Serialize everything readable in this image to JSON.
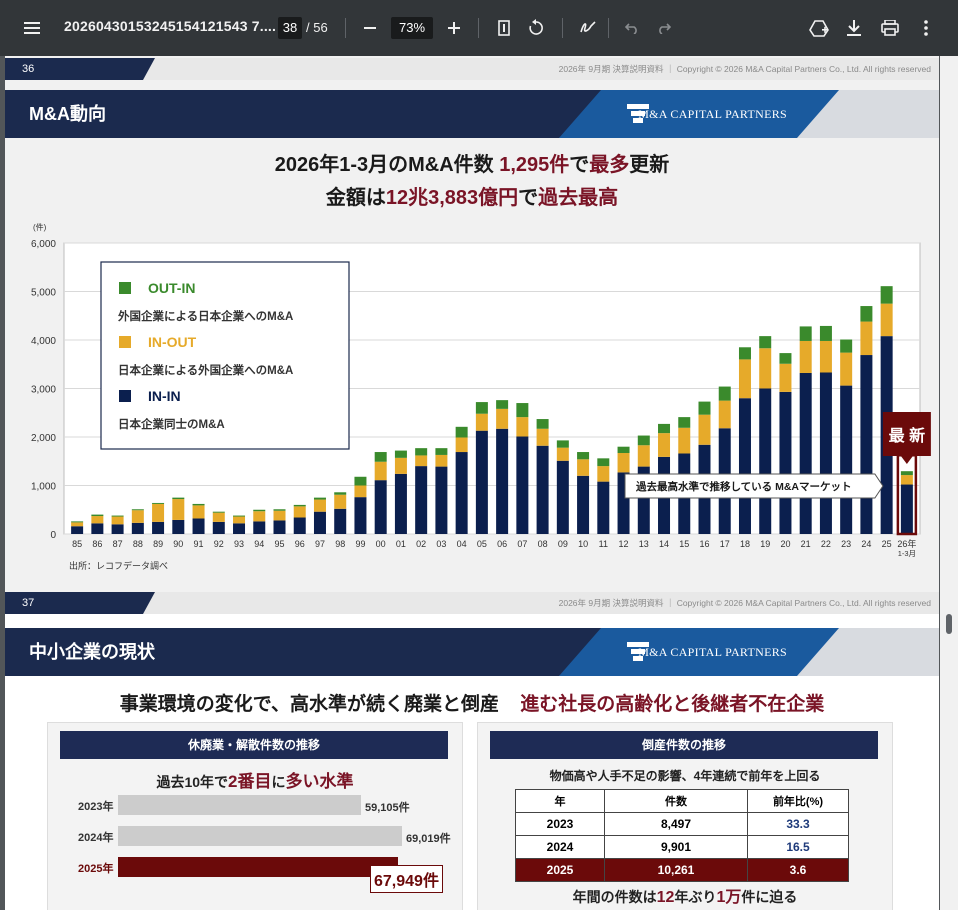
{
  "toolbar": {
    "menu_icon": "hamburger-menu-icon",
    "doc_title": "20260430153245154121543 7....",
    "page_current": "38",
    "page_total": "/ 56",
    "zoom": "73%",
    "icons": [
      "zoom-out-icon",
      "zoom-in-icon",
      "fit-page-icon",
      "rotate-icon",
      "annotate-icon",
      "undo-icon",
      "redo-icon",
      "drive-icon",
      "download-icon",
      "print-icon",
      "more-icon"
    ]
  },
  "page36": {
    "top_page_num": "36",
    "footer_copy": "2026年 9月期 決算説明資料 ｜ Copyright © 2026 M&A Capital Partners Co., Ltd. All rights reserved",
    "section_title": "M&A動向",
    "logo_text": "M&A CAPITAL PARTNERS",
    "headline1_a": "2026年1-3月のM&A件数 ",
    "headline1_b": "1,295件",
    "headline1_c": "で",
    "headline1_d": "最多",
    "headline1_e": "更新",
    "headline2_a": "金額は",
    "headline2_b": "12兆3,883億円",
    "headline2_c": "で",
    "headline2_d": "過去最高",
    "source": "出所：レコフデータ調べ",
    "badge": "最 新",
    "callout": "過去最高水準で推移している M&Aマーケット"
  },
  "chart_data": {
    "type": "bar",
    "stacked": true,
    "yunit": "(件)",
    "ylim": [
      0,
      6000
    ],
    "yticks": [
      "0",
      "1,000",
      "2,000",
      "3,000",
      "4,000",
      "5,000",
      "6,000"
    ],
    "categories": [
      "85",
      "86",
      "87",
      "88",
      "89",
      "90",
      "91",
      "92",
      "93",
      "94",
      "95",
      "96",
      "97",
      "98",
      "99",
      "00",
      "01",
      "02",
      "03",
      "04",
      "05",
      "06",
      "07",
      "08",
      "09",
      "10",
      "11",
      "12",
      "13",
      "14",
      "15",
      "16",
      "17",
      "18",
      "19",
      "20",
      "21",
      "22",
      "23",
      "24",
      "25",
      "26年\n1-3月"
    ],
    "series": [
      {
        "name": "IN-IN",
        "color": "#0b1f4e",
        "values": [
          160,
          220,
          200,
          230,
          250,
          290,
          320,
          250,
          220,
          260,
          280,
          340,
          460,
          520,
          760,
          1110,
          1240,
          1400,
          1390,
          1690,
          2130,
          2170,
          2010,
          1820,
          1510,
          1200,
          1080,
          1270,
          1390,
          1590,
          1660,
          1840,
          2180,
          2800,
          3000,
          2930,
          3320,
          3330,
          3060,
          3690,
          4080,
          1020
        ]
      },
      {
        "name": "OUT-IN",
        "color": "#3a8a2c",
        "values": [
          20,
          30,
          20,
          20,
          20,
          30,
          30,
          20,
          20,
          30,
          30,
          30,
          40,
          50,
          180,
          200,
          150,
          150,
          140,
          220,
          240,
          180,
          290,
          200,
          150,
          150,
          160,
          130,
          200,
          190,
          220,
          270,
          290,
          250,
          250,
          220,
          300,
          310,
          270,
          320,
          360,
          80
        ]
      },
      {
        "name": "IN-OUT",
        "color": "#e6aa2a",
        "values": [
          80,
          150,
          160,
          260,
          370,
          430,
          270,
          190,
          140,
          210,
          200,
          230,
          250,
          290,
          240,
          380,
          330,
          220,
          240,
          300,
          350,
          410,
          400,
          350,
          270,
          340,
          320,
          400,
          440,
          490,
          530,
          620,
          570,
          800,
          830,
          580,
          660,
          650,
          680,
          690,
          670,
          195
        ]
      }
    ],
    "legend": [
      {
        "name": "OUT-IN",
        "desc": "外国企業による日本企業へのM&A"
      },
      {
        "name": "IN-OUT",
        "desc": "日本企業による外国企業へのM&A"
      },
      {
        "name": "IN-IN",
        "desc": "日本企業同士のM&A"
      }
    ]
  },
  "page37": {
    "top_page_num": "37",
    "footer_copy": "2026年 9月期 決算説明資料 ｜ Copyright © 2026 M&A Capital Partners Co., Ltd. All rights reserved",
    "section_title": "中小企業の現状",
    "logo_text": "M&A CAPITAL PARTNERS",
    "headline_a": "事業環境の変化で、高水準が続く廃業と倒産",
    "headline_b": "進む社長の高齢化と後継者不在企業",
    "left_panel": {
      "title": "休廃業・解散件数の推移",
      "subtitle_a": "過去10年で",
      "subtitle_b": "2番目",
      "subtitle_c": "に",
      "subtitle_d": "多い水準",
      "rows": [
        {
          "label": "2023年",
          "value": 59105,
          "text": "59,105件"
        },
        {
          "label": "2024年",
          "value": 69019,
          "text": "69,019件"
        },
        {
          "label": "2025年",
          "value": 67949,
          "text": "67,949件"
        }
      ]
    },
    "right_panel": {
      "title": "倒産件数の推移",
      "subtitle": "物価高や人手不足の影響、4年連続で前年を上回る",
      "headers": [
        "年",
        "件数",
        "前年比(%)"
      ],
      "rows": [
        [
          "2023",
          "8,497",
          "33.3"
        ],
        [
          "2024",
          "9,901",
          "16.5"
        ],
        [
          "2025",
          "10,261",
          "3.6"
        ]
      ],
      "footer_a": "年間の件数は",
      "footer_b": "12",
      "footer_c": "年ぶり",
      "footer_d": "1万",
      "footer_e": "件に迫る"
    }
  }
}
